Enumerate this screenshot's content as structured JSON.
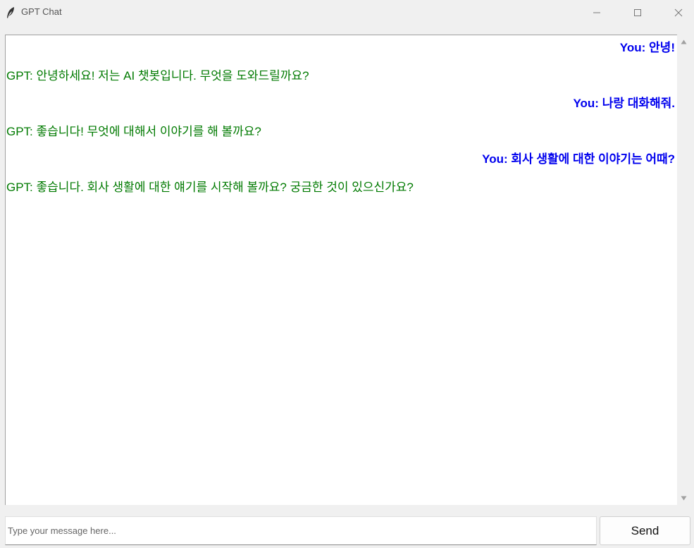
{
  "window": {
    "title": "GPT Chat",
    "icon": "feather-icon",
    "controls": [
      "minimize-icon",
      "maximize-icon",
      "close-icon"
    ]
  },
  "colors": {
    "user": "#0000ee",
    "gpt": "#007a00",
    "chat_bg": "#ffffff",
    "window_bg": "#f0f0f0"
  },
  "messages": [
    {
      "role": "user",
      "speaker": "You:",
      "text": "안녕!"
    },
    {
      "role": "gpt",
      "speaker": "GPT:",
      "text": "안녕하세요! 저는 AI 챗봇입니다. 무엇을 도와드릴까요?"
    },
    {
      "role": "user",
      "speaker": "You:",
      "text": "나랑 대화해줘."
    },
    {
      "role": "gpt",
      "speaker": "GPT:",
      "text": "좋습니다! 무엇에 대해서 이야기를 해 볼까요?"
    },
    {
      "role": "user",
      "speaker": "You:",
      "text": "회사 생활에 대한 이야기는 어때?"
    },
    {
      "role": "gpt",
      "speaker": "GPT:",
      "text": "좋습니다. 회사 생활에 대한 얘기를 시작해 볼까요? 궁금한 것이 있으신가요?"
    }
  ],
  "input": {
    "placeholder": "Type your message here...",
    "value": ""
  },
  "send_button": {
    "label": "Send"
  }
}
